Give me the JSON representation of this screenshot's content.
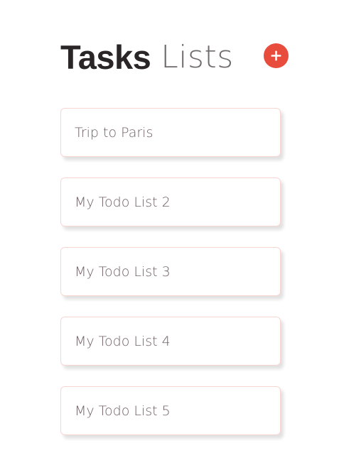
{
  "header": {
    "title_bold": "Tasks",
    "title_light": "Lists"
  },
  "add_button": {
    "icon": "plus-icon",
    "color": "#e74c3c"
  },
  "lists": [
    {
      "label": "Trip to Paris"
    },
    {
      "label": "My Todo List 2"
    },
    {
      "label": "My Todo List 3"
    },
    {
      "label": "My Todo List 4"
    },
    {
      "label": "My Todo List 5"
    }
  ],
  "colors": {
    "accent": "#e74c3c",
    "card_border": "#f7d6d2",
    "title_dark": "#2a2526",
    "title_light": "#6f6a6b",
    "card_text": "#6f5f63"
  }
}
